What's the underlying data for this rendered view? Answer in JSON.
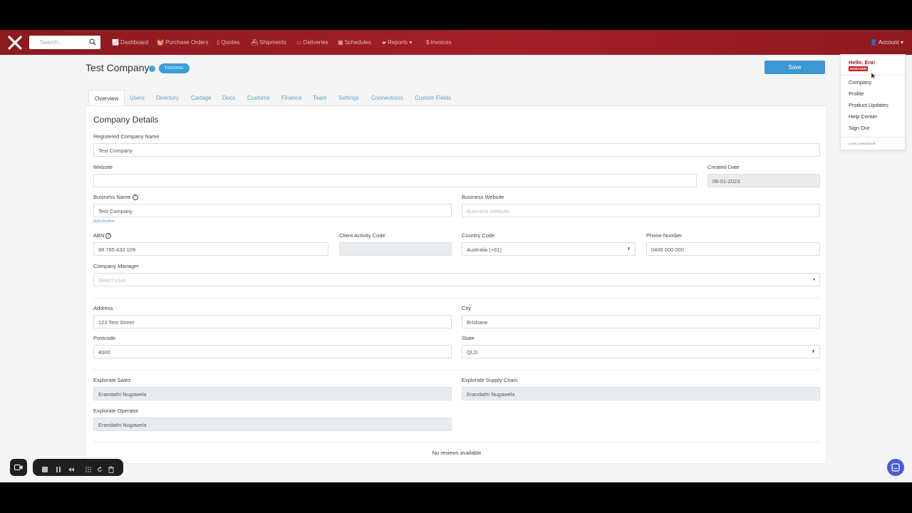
{
  "navbar": {
    "search_placeholder": "Search...",
    "items": [
      {
        "label": "Dashboard",
        "icon": "chart-icon"
      },
      {
        "label": "Purchase Orders",
        "icon": "basket-icon"
      },
      {
        "label": "Quotes",
        "icon": "document-icon"
      },
      {
        "label": "Shipments",
        "icon": "ship-icon"
      },
      {
        "label": "Deliveries",
        "icon": "calendar-icon"
      },
      {
        "label": "Schedules",
        "icon": "table-icon"
      },
      {
        "label": "Reports",
        "icon": "folder-icon"
      },
      {
        "label": "Invoices",
        "icon": "dollar-icon"
      }
    ],
    "account_label": "Account"
  },
  "header": {
    "company_title": "Test Company",
    "status_badge": "TRADING",
    "save_label": "Save"
  },
  "tabs": [
    "Overview",
    "Users",
    "Directory",
    "Cartage",
    "Docs",
    "Customs",
    "Finance",
    "Team",
    "Settings",
    "Connections",
    "Custom Fields"
  ],
  "form": {
    "section_title": "Company Details",
    "registered_name": {
      "label": "Registered Company Name",
      "value": "Test Company"
    },
    "website": {
      "label": "Website",
      "value": ""
    },
    "created_date": {
      "label": "Created Date",
      "value": "06-01-2023"
    },
    "business_name": {
      "label": "Business Name",
      "value": "Test Company",
      "add_link": "Add Another"
    },
    "business_website": {
      "label": "Business Website",
      "placeholder": "Business Website"
    },
    "abn": {
      "label": "ABN",
      "value": "98 765 432 109"
    },
    "client_activity_code": {
      "label": "Client Activity Code",
      "value": ""
    },
    "country_code": {
      "label": "Country Code",
      "value": "Australia (+61)"
    },
    "phone_number": {
      "label": "Phone Number",
      "value": "0400 000 000"
    },
    "company_manager": {
      "label": "Company Manager",
      "placeholder": "Select User"
    },
    "address": {
      "label": "Address",
      "value": "123 Test Street"
    },
    "city": {
      "label": "City",
      "value": "Brisbane"
    },
    "postcode": {
      "label": "Postcode",
      "value": "4000"
    },
    "state": {
      "label": "State",
      "value": "QLD"
    },
    "explorate_sales": {
      "label": "Explorate Sales",
      "value": "Erandathi Nugawela"
    },
    "explorate_supply_chain": {
      "label": "Explorate Supply Chain",
      "value": "Erandathi Nugawela"
    },
    "explorate_operator": {
      "label": "Explorate Operator",
      "value": "Erandathi Nugawela"
    },
    "reviews_text": "No reviews available"
  },
  "account_menu": {
    "greeting": "Hello, Era!",
    "role": "MANAGER",
    "items": [
      "Company",
      "Profile",
      "Product Updates",
      "Help Center",
      "Sign Out"
    ],
    "version": "v3.66.3-0e6381edf"
  },
  "colors": {
    "navbar": "#a41e26",
    "accent_blue": "#3d97d5",
    "badge": "#3c9ed8",
    "chat": "#4a5bdc"
  }
}
